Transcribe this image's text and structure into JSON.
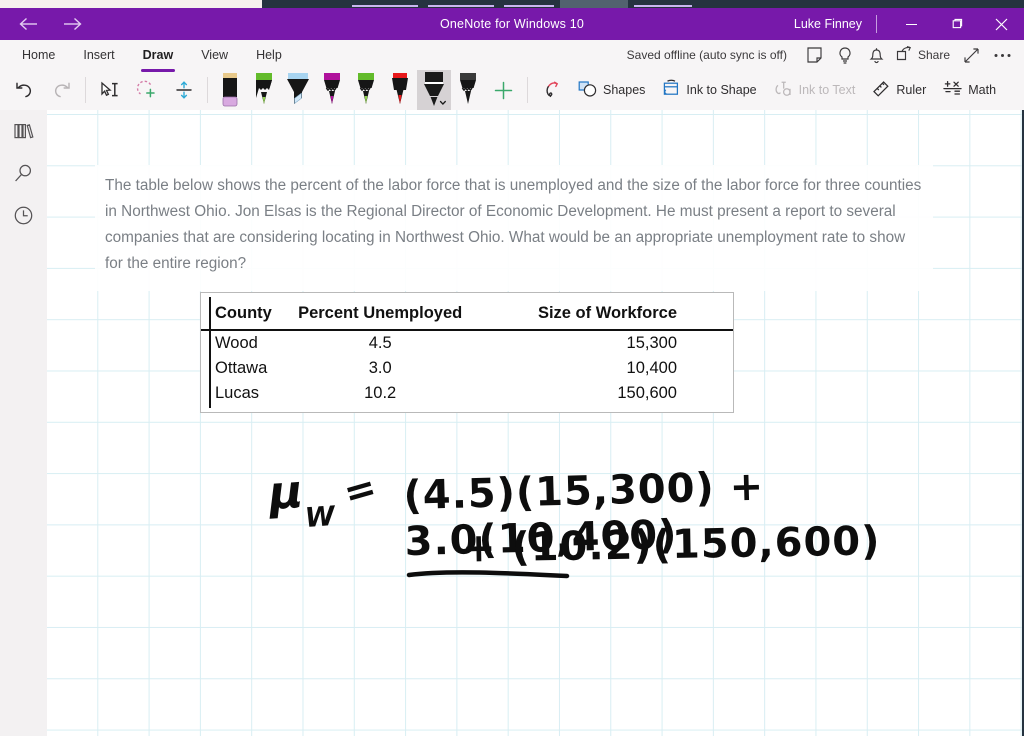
{
  "titlebar": {
    "back_icon": "arrow-left-icon",
    "forward_icon": "arrow-right-icon",
    "app_title": "OneNote for Windows 10",
    "user": "Luke Finney",
    "minimize_label": "Minimize",
    "maximize_label": "Restore",
    "close_label": "Close",
    "bg_color": "#7719aa"
  },
  "ribbon": {
    "tabs": [
      {
        "label": "Home",
        "active": false
      },
      {
        "label": "Insert",
        "active": false
      },
      {
        "label": "Draw",
        "active": true
      },
      {
        "label": "View",
        "active": false
      },
      {
        "label": "Help",
        "active": false
      }
    ],
    "status_text": "Saved offline (auto sync is off)",
    "status_icons": [
      "sticky-note-icon",
      "lightbulb-icon",
      "bell-icon"
    ],
    "share_label": "Share",
    "expand_icon": "expand-diagonal-icon",
    "more_icon": "ellipsis-icon",
    "accent_color": "#7719aa",
    "tools": [
      {
        "name": "undo",
        "icon": "undo-icon",
        "disabled": false
      },
      {
        "name": "redo",
        "icon": "redo-icon",
        "disabled": true
      },
      {
        "name": "select-text",
        "icon": "text-select-icon",
        "disabled": false
      },
      {
        "name": "lasso-select",
        "icon": "lasso-select-icon",
        "disabled": false
      },
      {
        "name": "insert-space",
        "icon": "insert-space-icon",
        "disabled": false
      }
    ],
    "pens": [
      {
        "name": "eraser",
        "type": "eraser",
        "color": "#d8a9e0",
        "cap": "#e8c98a",
        "selected": false
      },
      {
        "name": "pen-green",
        "type": "pen",
        "color": "#63bb2b",
        "selected": false
      },
      {
        "name": "highlighter-blue",
        "type": "highlighter",
        "color": "#a8d4f0",
        "selected": false
      },
      {
        "name": "pen-magenta",
        "type": "pen",
        "color": "#b0129c",
        "selected": false
      },
      {
        "name": "pen-lime",
        "type": "pen",
        "color": "#63bb2b",
        "selected": false
      },
      {
        "name": "pen-red",
        "type": "pen",
        "color": "#e8191b",
        "selected": false
      },
      {
        "name": "pen-black-selected",
        "type": "marker",
        "color": "#1a1a1a",
        "selected": true
      },
      {
        "name": "pen-black",
        "type": "pen",
        "color": "#1a1a1a",
        "selected": false
      }
    ],
    "add_pen_icon": "plus-icon",
    "actions": [
      {
        "name": "ink-replay",
        "icon": "ink-replay-icon",
        "label": "",
        "disabled": false
      },
      {
        "name": "shapes",
        "icon": "shapes-icon",
        "label": "Shapes",
        "disabled": false
      },
      {
        "name": "ink-to-shape",
        "icon": "ink-to-shape-icon",
        "label": "Ink to Shape",
        "disabled": false
      },
      {
        "name": "ink-to-text",
        "icon": "ink-to-text-icon",
        "label": "Ink to Text",
        "disabled": true
      },
      {
        "name": "ruler",
        "icon": "ruler-icon",
        "label": "Ruler",
        "disabled": false
      },
      {
        "name": "math",
        "icon": "math-icon",
        "label": "Math",
        "disabled": false
      }
    ]
  },
  "rail": {
    "items": [
      {
        "name": "notebooks",
        "icon": "notebooks-icon"
      },
      {
        "name": "search",
        "icon": "search-icon"
      },
      {
        "name": "recent",
        "icon": "clock-icon"
      }
    ]
  },
  "page": {
    "paragraph": "The table below shows the percent of the labor force that is unemployed and the size of the labor force for three counties in Northwest Ohio. Jon Elsas is the Regional Director of Economic Development. He must present a report to several companies that are considering locating in Northwest Ohio. What would be an appropriate unemployment rate to show for the entire region?",
    "table": {
      "headers": [
        "County",
        "Percent Unemployed",
        "Size of Workforce"
      ],
      "rows": [
        [
          "Wood",
          "4.5",
          "15,300"
        ],
        [
          "Ottawa",
          "3.0",
          "10,400"
        ],
        [
          "Lucas",
          "10.2",
          "150,600"
        ]
      ]
    },
    "ink": {
      "symbol": "μ",
      "subscript": "W",
      "equals": "=",
      "line1": "(4.5)(15,300) + 3.0(10,400)",
      "line2": "+ (10.2)(150,600)",
      "color": "#0d0d0d"
    }
  }
}
